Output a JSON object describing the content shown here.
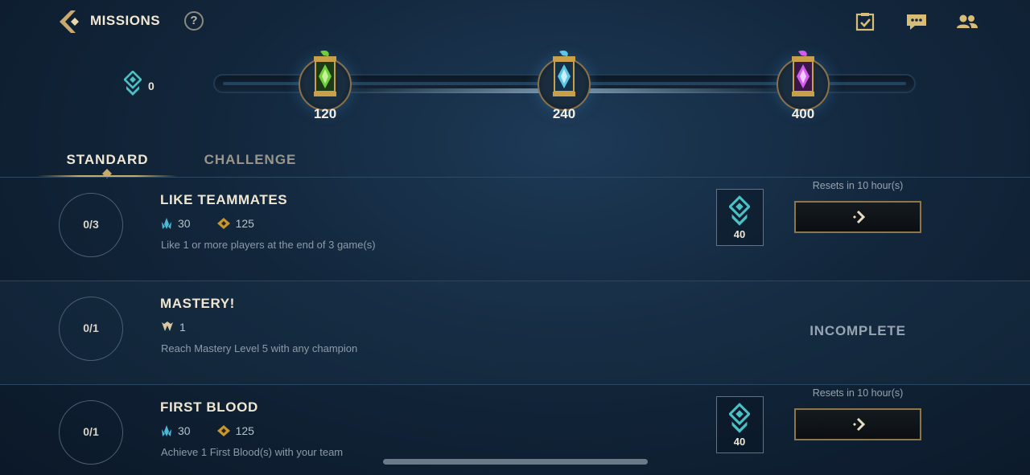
{
  "header": {
    "title": "MISSIONS",
    "help_label": "?",
    "icons": [
      "back-chevron-icon",
      "checklist-icon",
      "chat-icon",
      "friends-icon"
    ]
  },
  "progress": {
    "points": "0",
    "points_icon": "mission-token-icon",
    "milestones": [
      {
        "value": "120",
        "capsule": "green-capsule-icon",
        "color": "#6fcf3b"
      },
      {
        "value": "240",
        "capsule": "blue-capsule-icon",
        "color": "#5cc6e8"
      },
      {
        "value": "400",
        "capsule": "purple-capsule-icon",
        "color": "#d35cf0"
      }
    ]
  },
  "tabs": [
    {
      "label": "STANDARD",
      "active": true
    },
    {
      "label": "CHALLENGE",
      "active": false
    }
  ],
  "missions": [
    {
      "counter": "0/3",
      "title": "LIKE TEAMMATES",
      "rewards": [
        {
          "icon": "blue-essence-icon",
          "value": "30"
        },
        {
          "icon": "gold-rp-icon",
          "value": "125"
        }
      ],
      "description": "Like 1 or more players at the end of 3 game(s)",
      "token_value": "40",
      "resets": "Resets in 10 hour(s)",
      "action_icon": "arrow-right-icon"
    },
    {
      "counter": "0/1",
      "title": "MASTERY!",
      "rewards": [
        {
          "icon": "mastery-icon",
          "value": "1"
        }
      ],
      "description": "Reach Mastery Level 5 with any champion",
      "status": "INCOMPLETE"
    },
    {
      "counter": "0/1",
      "title": "FIRST BLOOD",
      "rewards": [
        {
          "icon": "blue-essence-icon",
          "value": "30"
        },
        {
          "icon": "gold-rp-icon",
          "value": "125"
        }
      ],
      "description": "Achieve 1 First Blood(s) with your team",
      "token_value": "40",
      "resets": "Resets in 10 hour(s)",
      "action_icon": "arrow-right-icon"
    }
  ],
  "colors": {
    "accent_gold": "#c8aa6e",
    "token_teal": "#4bc1c6",
    "background": "#12263b"
  }
}
